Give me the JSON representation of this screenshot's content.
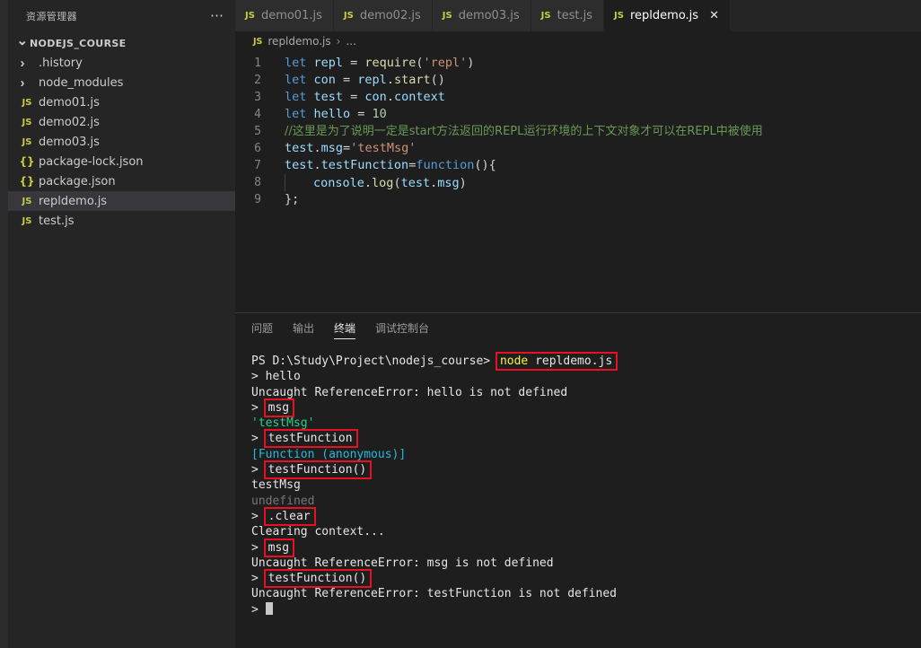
{
  "sidebar": {
    "header_title": "资源管理器",
    "more_icon": "ellipsis-icon",
    "root": {
      "label": "NODEJS_COURSE",
      "twisty": "chevron-down-icon"
    },
    "items": [
      {
        "label": ".history",
        "kind": "folder",
        "icon": "chevron-right-icon",
        "selected": false
      },
      {
        "label": "node_modules",
        "kind": "folder",
        "icon": "chevron-right-icon",
        "selected": false
      },
      {
        "label": "demo01.js",
        "kind": "js",
        "icon": "js-file-icon",
        "badge": "JS",
        "selected": false
      },
      {
        "label": "demo02.js",
        "kind": "js",
        "icon": "js-file-icon",
        "badge": "JS",
        "selected": false
      },
      {
        "label": "demo03.js",
        "kind": "js",
        "icon": "js-file-icon",
        "badge": "JS",
        "selected": false
      },
      {
        "label": "package-lock.json",
        "kind": "json",
        "icon": "json-file-icon",
        "badge": "{}",
        "selected": false
      },
      {
        "label": "package.json",
        "kind": "json",
        "icon": "json-file-icon",
        "badge": "{}",
        "selected": false
      },
      {
        "label": "repldemo.js",
        "kind": "js",
        "icon": "js-file-icon",
        "badge": "JS",
        "selected": true
      },
      {
        "label": "test.js",
        "kind": "js",
        "icon": "js-file-icon",
        "badge": "JS",
        "selected": false
      }
    ]
  },
  "tabs": [
    {
      "label": "demo01.js",
      "badge": "JS",
      "active": false,
      "closable": false
    },
    {
      "label": "demo02.js",
      "badge": "JS",
      "active": false,
      "closable": false
    },
    {
      "label": "demo03.js",
      "badge": "JS",
      "active": false,
      "closable": false
    },
    {
      "label": "test.js",
      "badge": "JS",
      "active": false,
      "closable": false
    },
    {
      "label": "repldemo.js",
      "badge": "JS",
      "active": true,
      "closable": true,
      "close_icon": "close-icon"
    }
  ],
  "breadcrumb": {
    "badge": "JS",
    "file": "repldemo.js",
    "separator": "›",
    "tail": "..."
  },
  "editor": {
    "lines": [
      {
        "n": "1",
        "tokens": [
          {
            "t": "let ",
            "c": "kw"
          },
          {
            "t": "repl",
            "c": "var"
          },
          {
            "t": " = ",
            "c": "pl"
          },
          {
            "t": "require",
            "c": "fn"
          },
          {
            "t": "(",
            "c": "pl"
          },
          {
            "t": "'repl'",
            "c": "str"
          },
          {
            "t": ")",
            "c": "pl"
          }
        ]
      },
      {
        "n": "2",
        "tokens": [
          {
            "t": "let ",
            "c": "kw"
          },
          {
            "t": "con",
            "c": "var"
          },
          {
            "t": " = ",
            "c": "pl"
          },
          {
            "t": "repl",
            "c": "var"
          },
          {
            "t": ".",
            "c": "pl"
          },
          {
            "t": "start",
            "c": "fn"
          },
          {
            "t": "()",
            "c": "pl"
          }
        ]
      },
      {
        "n": "3",
        "tokens": [
          {
            "t": "let ",
            "c": "kw"
          },
          {
            "t": "test",
            "c": "var"
          },
          {
            "t": " = ",
            "c": "pl"
          },
          {
            "t": "con",
            "c": "var"
          },
          {
            "t": ".",
            "c": "pl"
          },
          {
            "t": "context",
            "c": "prop"
          }
        ]
      },
      {
        "n": "4",
        "tokens": [
          {
            "t": "let ",
            "c": "kw"
          },
          {
            "t": "hello",
            "c": "var"
          },
          {
            "t": " = ",
            "c": "pl"
          },
          {
            "t": "10",
            "c": "num"
          }
        ]
      },
      {
        "n": "5",
        "tokens": [
          {
            "t": "//这里是为了说明一定是start方法返回的REPL运行环境的上下文对象才可以在REPL中被使用",
            "c": "cmtcn"
          }
        ]
      },
      {
        "n": "6",
        "tokens": [
          {
            "t": "test",
            "c": "var"
          },
          {
            "t": ".",
            "c": "pl"
          },
          {
            "t": "msg",
            "c": "prop"
          },
          {
            "t": "=",
            "c": "pl"
          },
          {
            "t": "'testMsg'",
            "c": "str"
          }
        ]
      },
      {
        "n": "7",
        "tokens": [
          {
            "t": "test",
            "c": "var"
          },
          {
            "t": ".",
            "c": "pl"
          },
          {
            "t": "testFunction",
            "c": "prop"
          },
          {
            "t": "=",
            "c": "pl"
          },
          {
            "t": "function",
            "c": "kw"
          },
          {
            "t": "(){",
            "c": "pl"
          }
        ]
      },
      {
        "n": "8",
        "indent": true,
        "tokens": [
          {
            "t": "console",
            "c": "var"
          },
          {
            "t": ".",
            "c": "pl"
          },
          {
            "t": "log",
            "c": "fn"
          },
          {
            "t": "(",
            "c": "pl"
          },
          {
            "t": "test",
            "c": "var"
          },
          {
            "t": ".",
            "c": "pl"
          },
          {
            "t": "msg",
            "c": "prop"
          },
          {
            "t": ")",
            "c": "pl"
          }
        ]
      },
      {
        "n": "9",
        "tokens": [
          {
            "t": "};",
            "c": "pl"
          }
        ]
      }
    ]
  },
  "panel": {
    "tabs": [
      {
        "label": "问题",
        "active": false
      },
      {
        "label": "输出",
        "active": false
      },
      {
        "label": "终端",
        "active": true
      },
      {
        "label": "调试控制台",
        "active": false
      }
    ]
  },
  "terminal": {
    "highlight_color": "#e81123",
    "lines": [
      {
        "segs": [
          {
            "t": "PS D:\\Study\\Project\\nodejs_course>",
            "c": "t-white"
          },
          {
            "t": " ",
            "c": "t-white"
          },
          {
            "t": "node",
            "c": "t-yellow",
            "hl": true,
            "hlgroup": "start"
          },
          {
            "t": " repldemo.js",
            "c": "t-white",
            "hl": true,
            "hlgroup": "end"
          }
        ]
      },
      {
        "segs": [
          {
            "t": "> hello",
            "c": "t-white"
          }
        ]
      },
      {
        "segs": [
          {
            "t": "Uncaught ReferenceError: hello is not defined",
            "c": "t-white"
          }
        ]
      },
      {
        "segs": [
          {
            "t": "> ",
            "c": "t-white"
          },
          {
            "t": "msg",
            "c": "t-white",
            "hl": true
          }
        ]
      },
      {
        "segs": [
          {
            "t": "'testMsg'",
            "c": "t-green"
          }
        ]
      },
      {
        "segs": [
          {
            "t": "> ",
            "c": "t-white"
          },
          {
            "t": "testFunction",
            "c": "t-white",
            "hl": true
          }
        ]
      },
      {
        "segs": [
          {
            "t": "[Function (anonymous)]",
            "c": "t-cyan"
          }
        ]
      },
      {
        "segs": [
          {
            "t": "> ",
            "c": "t-white"
          },
          {
            "t": "testFunction()",
            "c": "t-white",
            "hl": true
          }
        ]
      },
      {
        "segs": [
          {
            "t": "testMsg",
            "c": "t-white"
          }
        ]
      },
      {
        "segs": [
          {
            "t": "undefined",
            "c": "t-dim"
          }
        ]
      },
      {
        "segs": [
          {
            "t": "> ",
            "c": "t-white"
          },
          {
            "t": ".clear",
            "c": "t-white",
            "hl": true
          }
        ]
      },
      {
        "segs": [
          {
            "t": "Clearing context...",
            "c": "t-white"
          }
        ]
      },
      {
        "segs": [
          {
            "t": "> ",
            "c": "t-white"
          },
          {
            "t": "msg",
            "c": "t-white",
            "hl": true
          }
        ]
      },
      {
        "segs": [
          {
            "t": "Uncaught ReferenceError: msg is not defined",
            "c": "t-white"
          }
        ]
      },
      {
        "segs": [
          {
            "t": "> ",
            "c": "t-white"
          },
          {
            "t": "testFunction()",
            "c": "t-white",
            "hl": true
          }
        ]
      },
      {
        "segs": [
          {
            "t": "Uncaught ReferenceError: testFunction is not defined",
            "c": "t-white"
          }
        ]
      },
      {
        "segs": [
          {
            "t": "> ",
            "c": "t-white"
          },
          {
            "t": "",
            "c": "cursor"
          }
        ]
      }
    ]
  }
}
